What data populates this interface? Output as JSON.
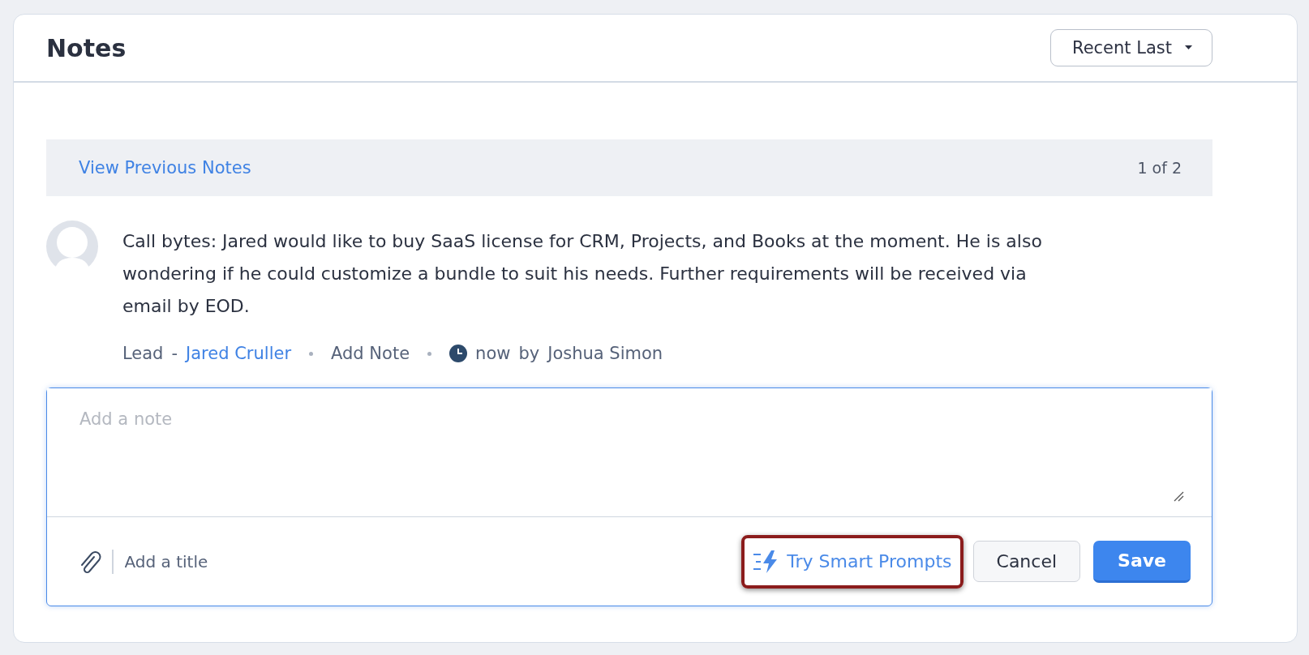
{
  "header": {
    "title": "Notes",
    "sort_dropdown": "Recent Last"
  },
  "previous_bar": {
    "link": "View Previous Notes",
    "count": "1 of 2"
  },
  "note": {
    "text": "Call bytes: Jared would like to buy SaaS license for CRM, Projects, and Books at the moment. He is also wondering if he could customize a bundle to suit his needs. Further requirements will be received via email by EOD.",
    "module": "Lead",
    "separator": "-",
    "record": "Jared Cruller",
    "action": "Add Note",
    "time": "now",
    "by": "by",
    "author": "Joshua Simon"
  },
  "editor": {
    "placeholder": "Add a note",
    "title_placeholder": "Add a title",
    "buttons": [
      {
        "kind": "prompt",
        "label": "Try Smart Prompts",
        "highlighted": true
      },
      {
        "kind": "secondary",
        "label": "Cancel"
      },
      {
        "kind": "primary",
        "label": "Save"
      }
    ]
  }
}
